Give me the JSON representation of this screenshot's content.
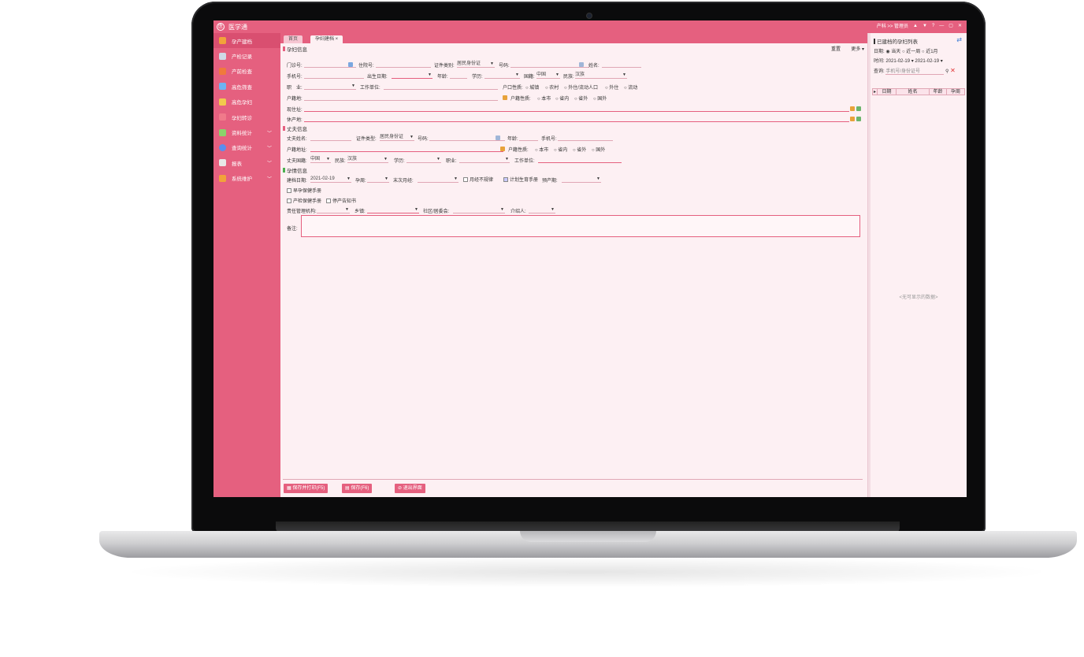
{
  "app": {
    "title": "医学通",
    "logo_text": "医"
  },
  "titlebar": {
    "user_text": "产科 >> 管理员",
    "controls": [
      "▲",
      "▼",
      "?",
      "—",
      "▢",
      "✕"
    ]
  },
  "sidebar": {
    "items": [
      {
        "label": "孕产建档",
        "color": "#f2a33a",
        "active": true
      },
      {
        "label": "产检记录",
        "color": "#cfd8e6",
        "active": false
      },
      {
        "label": "产前检查",
        "color": "#f07a3c",
        "active": false
      },
      {
        "label": "高危筛查",
        "color": "#6db3f2",
        "active": false
      },
      {
        "label": "高危孕妇",
        "color": "#f2c94c",
        "active": false
      },
      {
        "label": "孕妇转诊",
        "color": "#f07a8a",
        "active": false
      },
      {
        "label": "资料统计",
        "color": "#8ad36b",
        "active": false,
        "chevron": "﹀"
      },
      {
        "label": "查询统计",
        "color": "#5b8def",
        "active": false,
        "chevron": "﹀"
      },
      {
        "label": "报表",
        "color": "#e8e8e8",
        "active": false,
        "chevron": "﹀"
      },
      {
        "label": "系统维护",
        "color": "#f2a33a",
        "active": false,
        "chevron": "﹀"
      }
    ]
  },
  "tabs": [
    {
      "label": "首页"
    },
    {
      "label": "孕妇建档 ×"
    }
  ],
  "panel": {
    "title": "孕妇信息",
    "reset": "重置",
    "more": "更多 ▾"
  },
  "form": {
    "r1": {
      "clinic_label": "门诊号:",
      "hosp_label": "住院号:",
      "idtype_label": "证件类别:",
      "idtype_value": "居民身份证",
      "idno_label": "号码:",
      "name_label": "姓名:"
    },
    "r2": {
      "phone_label": "手机号:",
      "birth_label": "出生日期:",
      "age_label": "年龄:",
      "edu_label": "学历:",
      "nation_label": "国籍:",
      "nation_value": "中国",
      "ethnic_label": "民族:",
      "ethnic_value": "汉族"
    },
    "r3": {
      "job_label": "职　业:",
      "work_label": "工作单位:",
      "hukou_label": "户口性质:",
      "hukou_opts": [
        "城镇",
        "农村",
        "外住/流动人口",
        "外住",
        "流动"
      ]
    },
    "r4": {
      "huji_label": "户籍地:",
      "hujiattr_label": "户籍性质:",
      "hujiattr_opts": [
        "本市",
        "省内",
        "省外",
        "国外"
      ]
    },
    "r5": {
      "addr_label": "现住址:"
    },
    "r6": {
      "post_label": "休产地:"
    },
    "husband": {
      "title": "丈夫信息",
      "name_label": "丈夫姓名:",
      "idtype_label": "证件类型:",
      "idtype_value": "居民身份证",
      "idno_label": "号码:",
      "age_label": "年龄:",
      "phone_label": "手机号:",
      "huji_label": "户籍地址:",
      "hujiattr_label": "户籍性质:",
      "hujiattr_opts": [
        "本市",
        "省内",
        "省外",
        "国外"
      ],
      "nation_label": "丈夫国籍:",
      "nation_value": "中国",
      "ethnic_label": "民族:",
      "ethnic_value": "汉族",
      "edu_label": "学历:",
      "job_label": "职业:",
      "work_label": "工作单位:"
    },
    "preg": {
      "title": "孕情信息",
      "date_label": "建档日期:",
      "date_value": "2021-02-19",
      "gestweek_label": "孕周:",
      "lmp_label": "末次月经:",
      "unsure_label": "月经不规律",
      "plan_label": "计划生育手册",
      "edd_label": "预产期:",
      "early_label": "早孕保健手册",
      "check_label": "产检保健手册",
      "notified_label": "停产告知书",
      "resp_label": "责任管理机构:",
      "town_label": "乡镇:",
      "village_label": "社区/居委会:",
      "intro_label": "介绍人:",
      "remark_label": "备注:"
    }
  },
  "buttons": {
    "save_print": "保存并打印(F5)",
    "save": "保存(F6)",
    "exit": "退出界面"
  },
  "right": {
    "title": "已建档的孕妇列表",
    "filter_label": "日期:",
    "filter_opts": [
      "当天",
      "近一周",
      "近1月"
    ],
    "date_label": "时间:",
    "date_from": "2021-02-19",
    "date_to": "2021-02-19",
    "search_label": "查询:",
    "search_placeholder": "手机号/身份证号",
    "columns": [
      "日期",
      "姓名",
      "年龄",
      "孕周"
    ],
    "empty": "<无可显示的数据>"
  }
}
